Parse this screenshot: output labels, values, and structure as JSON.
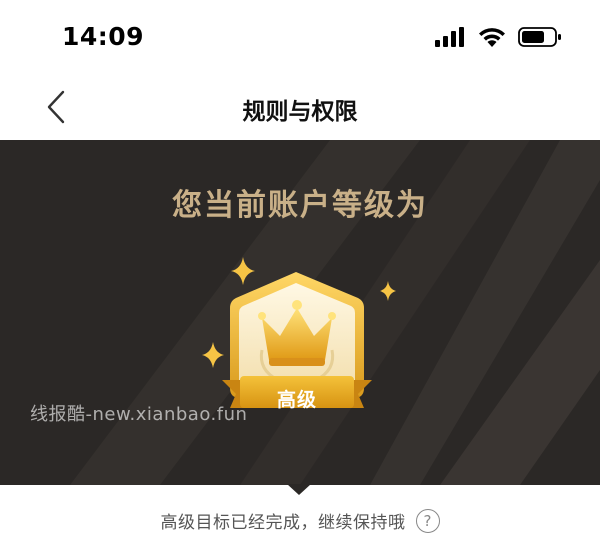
{
  "status_bar": {
    "time": "14:09",
    "icons": [
      "cellular-signal-icon",
      "wifi-icon",
      "battery-icon"
    ]
  },
  "nav": {
    "title": "规则与权限",
    "back_icon": "chevron-left-icon"
  },
  "hero": {
    "heading": "您当前账户等级为",
    "level_label": "高级",
    "watermark": "线报酷-new.xianbao.fun",
    "badge_icon": "crown-icon",
    "colors": {
      "background": "#2b2826",
      "heading": "#c9b088",
      "gold": "#e8b83a"
    }
  },
  "tip": {
    "text": "高级目标已经完成，继续保持哦",
    "help_glyph": "?"
  }
}
